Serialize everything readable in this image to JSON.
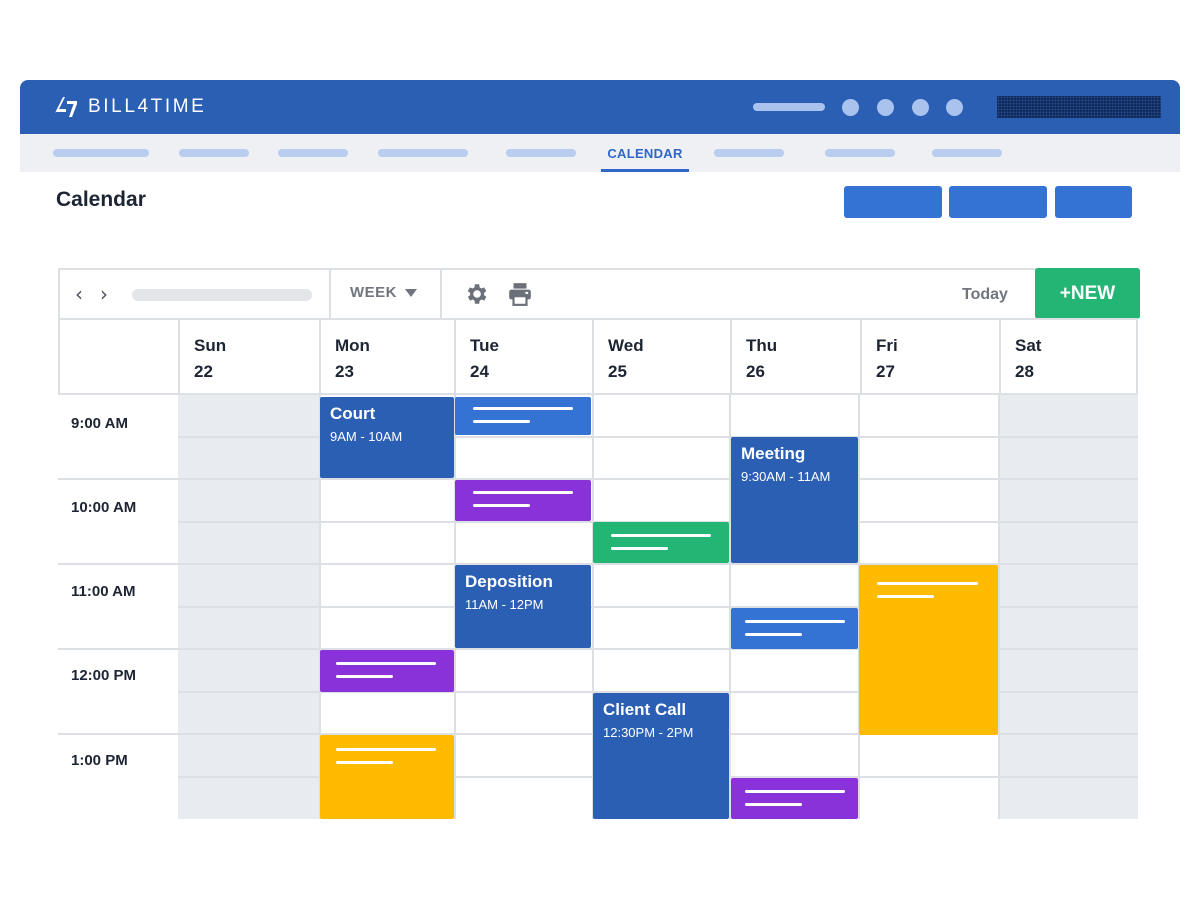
{
  "app": {
    "name": "BILL4TIME"
  },
  "nav": {
    "active_label": "CALENDAR"
  },
  "page": {
    "title": "Calendar"
  },
  "toolbar": {
    "view_label": "WEEK",
    "today_label": "Today",
    "new_label": "+NEW",
    "icons": [
      "chevron-left-icon",
      "chevron-right-icon",
      "gear-icon",
      "printer-icon"
    ]
  },
  "days": [
    {
      "name": "Sun",
      "date": "22"
    },
    {
      "name": "Mon",
      "date": "23"
    },
    {
      "name": "Tue",
      "date": "24"
    },
    {
      "name": "Wed",
      "date": "25"
    },
    {
      "name": "Thu",
      "date": "26"
    },
    {
      "name": "Fri",
      "date": "27"
    },
    {
      "name": "Sat",
      "date": "28"
    }
  ],
  "times": [
    "9:00 AM",
    "10:00 AM",
    "11:00 AM",
    "12:00 PM",
    "1:00 PM"
  ],
  "events": [
    {
      "title": "Court",
      "time": "9AM - 10AM",
      "color": "#2b5fb4"
    },
    {
      "title": "Deposition",
      "time": "11AM - 12PM",
      "color": "#2b5fb4"
    },
    {
      "title": "Meeting",
      "time": "9:30AM - 11AM",
      "color": "#2b5fb4"
    },
    {
      "title": "Client Call",
      "time": "12:30PM - 2PM",
      "color": "#2b5fb4"
    }
  ],
  "colors": {
    "brand_blue": "#2b5fb4",
    "accent_blue": "#3473d4",
    "purple": "#8a32d9",
    "green": "#22b573",
    "yellow": "#ffbb00"
  }
}
